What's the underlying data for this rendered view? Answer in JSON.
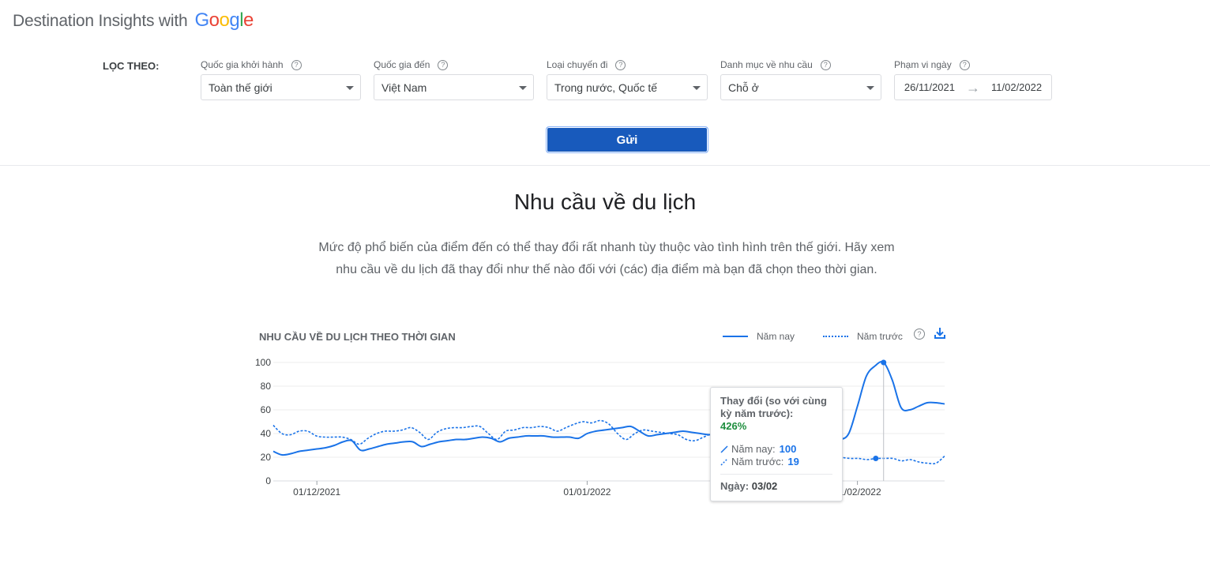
{
  "header": {
    "title": "Destination Insights with",
    "logo_text": "Google",
    "logo_colors": [
      "#4285f4",
      "#ea4335",
      "#fbbc05",
      "#4285f4",
      "#34a853",
      "#ea4335"
    ]
  },
  "filters": {
    "label": "LỌC THEO:",
    "origin": {
      "label": "Quốc gia khởi hành",
      "value": "Toàn thế giới"
    },
    "destination": {
      "label": "Quốc gia đến",
      "value": "Việt Nam"
    },
    "trip_type": {
      "label": "Loại chuyến đi",
      "value": "Trong nước, Quốc tế"
    },
    "category": {
      "label": "Danh mục về nhu cầu",
      "value": "Chỗ ở"
    },
    "date_range": {
      "label": "Phạm vi ngày",
      "start": "26/11/2021",
      "end": "11/02/2022",
      "arrow": "→"
    },
    "help_symbol": "?"
  },
  "submit_label": "Gửi",
  "section": {
    "title": "Nhu cầu về du lịch",
    "description": "Mức độ phổ biến của điểm đến có thể thay đổi rất nhanh tùy thuộc vào tình hình trên thế giới. Hãy xem nhu cầu về du lịch đã thay đổi như thế nào đối với (các) địa điểm mà bạn đã chọn theo thời gian."
  },
  "chart_header": {
    "title": "NHU CẦU VỀ DU LỊCH THEO THỜI GIAN",
    "legend_current": "Năm nay",
    "legend_previous": "Năm trước"
  },
  "colors": {
    "accent": "#1a73e8",
    "button": "#185abc",
    "positive": "#1e8e3e"
  },
  "chart_data": {
    "type": "line",
    "x_start": "26/11/2021",
    "x_end": "11/02/2022",
    "x_ticks": [
      "01/12/2021",
      "01/01/2022",
      "01/02/2022"
    ],
    "y_ticks": [
      0,
      20,
      40,
      60,
      80,
      100
    ],
    "ylim": [
      0,
      100
    ],
    "grid": true,
    "legend_position": "top-right",
    "series": [
      {
        "name": "Năm nay",
        "style": "solid",
        "values": [
          25,
          22,
          23,
          25,
          26,
          27,
          28,
          30,
          33,
          34,
          26,
          27,
          29,
          31,
          32,
          33,
          33,
          29,
          31,
          33,
          34,
          35,
          35,
          36,
          37,
          36,
          33,
          36,
          37,
          38,
          38,
          38,
          37,
          37,
          37,
          36,
          40,
          42,
          43,
          44,
          45,
          46,
          42,
          38,
          39,
          40,
          41,
          42,
          41,
          40,
          39,
          40,
          41,
          42,
          42,
          41,
          40,
          38,
          37,
          38,
          38,
          38,
          37,
          36,
          36,
          35,
          40,
          63,
          88,
          97,
          100,
          85,
          62,
          60,
          63,
          66,
          66,
          65
        ]
      },
      {
        "name": "Năm trước",
        "style": "dotted",
        "values": [
          47,
          40,
          39,
          42,
          42,
          38,
          37,
          37,
          37,
          35,
          31,
          36,
          40,
          42,
          42,
          43,
          45,
          41,
          35,
          41,
          44,
          45,
          45,
          46,
          46,
          40,
          35,
          42,
          43,
          45,
          45,
          46,
          45,
          42,
          45,
          48,
          50,
          49,
          51,
          48,
          40,
          35,
          40,
          43,
          42,
          41,
          40,
          39,
          35,
          34,
          37,
          40,
          41,
          40,
          40,
          42,
          39,
          35,
          33,
          37,
          40,
          42,
          38,
          35,
          30,
          22,
          20,
          19,
          19,
          18,
          19,
          19,
          19,
          17,
          18,
          16,
          15,
          15,
          21
        ]
      }
    ],
    "highlight": {
      "series_index": 0,
      "x_label": "03/02"
    }
  },
  "tooltip": {
    "heading": "Thay đổi (so với cùng kỳ năm trước):",
    "change_pct": "426%",
    "current_label": "Năm nay:",
    "current_value": "100",
    "previous_label": "Năm trước:",
    "previous_value": "19",
    "date_label": "Ngày:",
    "date_value": "03/02"
  }
}
